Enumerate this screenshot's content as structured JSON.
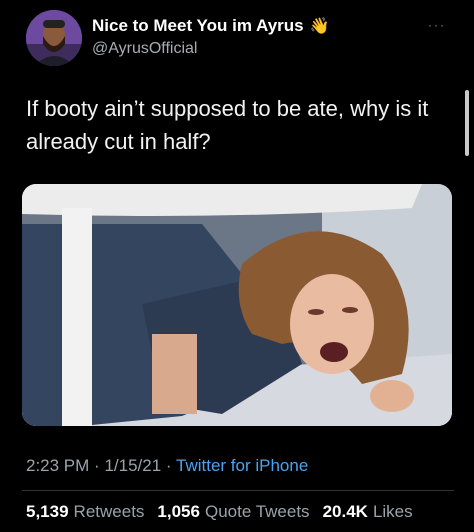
{
  "author": {
    "display_name": "Nice to Meet You im Ayrus",
    "handle": "@AyrusOfficial",
    "name_emoji": "👋"
  },
  "more_label": "···",
  "tweet": {
    "text": "If booty ain’t supposed to be ate, why is it already cut in half?"
  },
  "meta": {
    "time": "2:23 PM",
    "date": "1/15/21",
    "separator": "·",
    "source": "Twitter for iPhone"
  },
  "stats": {
    "retweets_count": "5,139",
    "retweets_label": "Retweets",
    "quotes_count": "1,056",
    "quotes_label": "Quote Tweets",
    "likes_count": "20.4K",
    "likes_label": "Likes"
  },
  "colors": {
    "background": "#000000",
    "link": "#4aa3ee",
    "muted": "#9aa3ab"
  }
}
